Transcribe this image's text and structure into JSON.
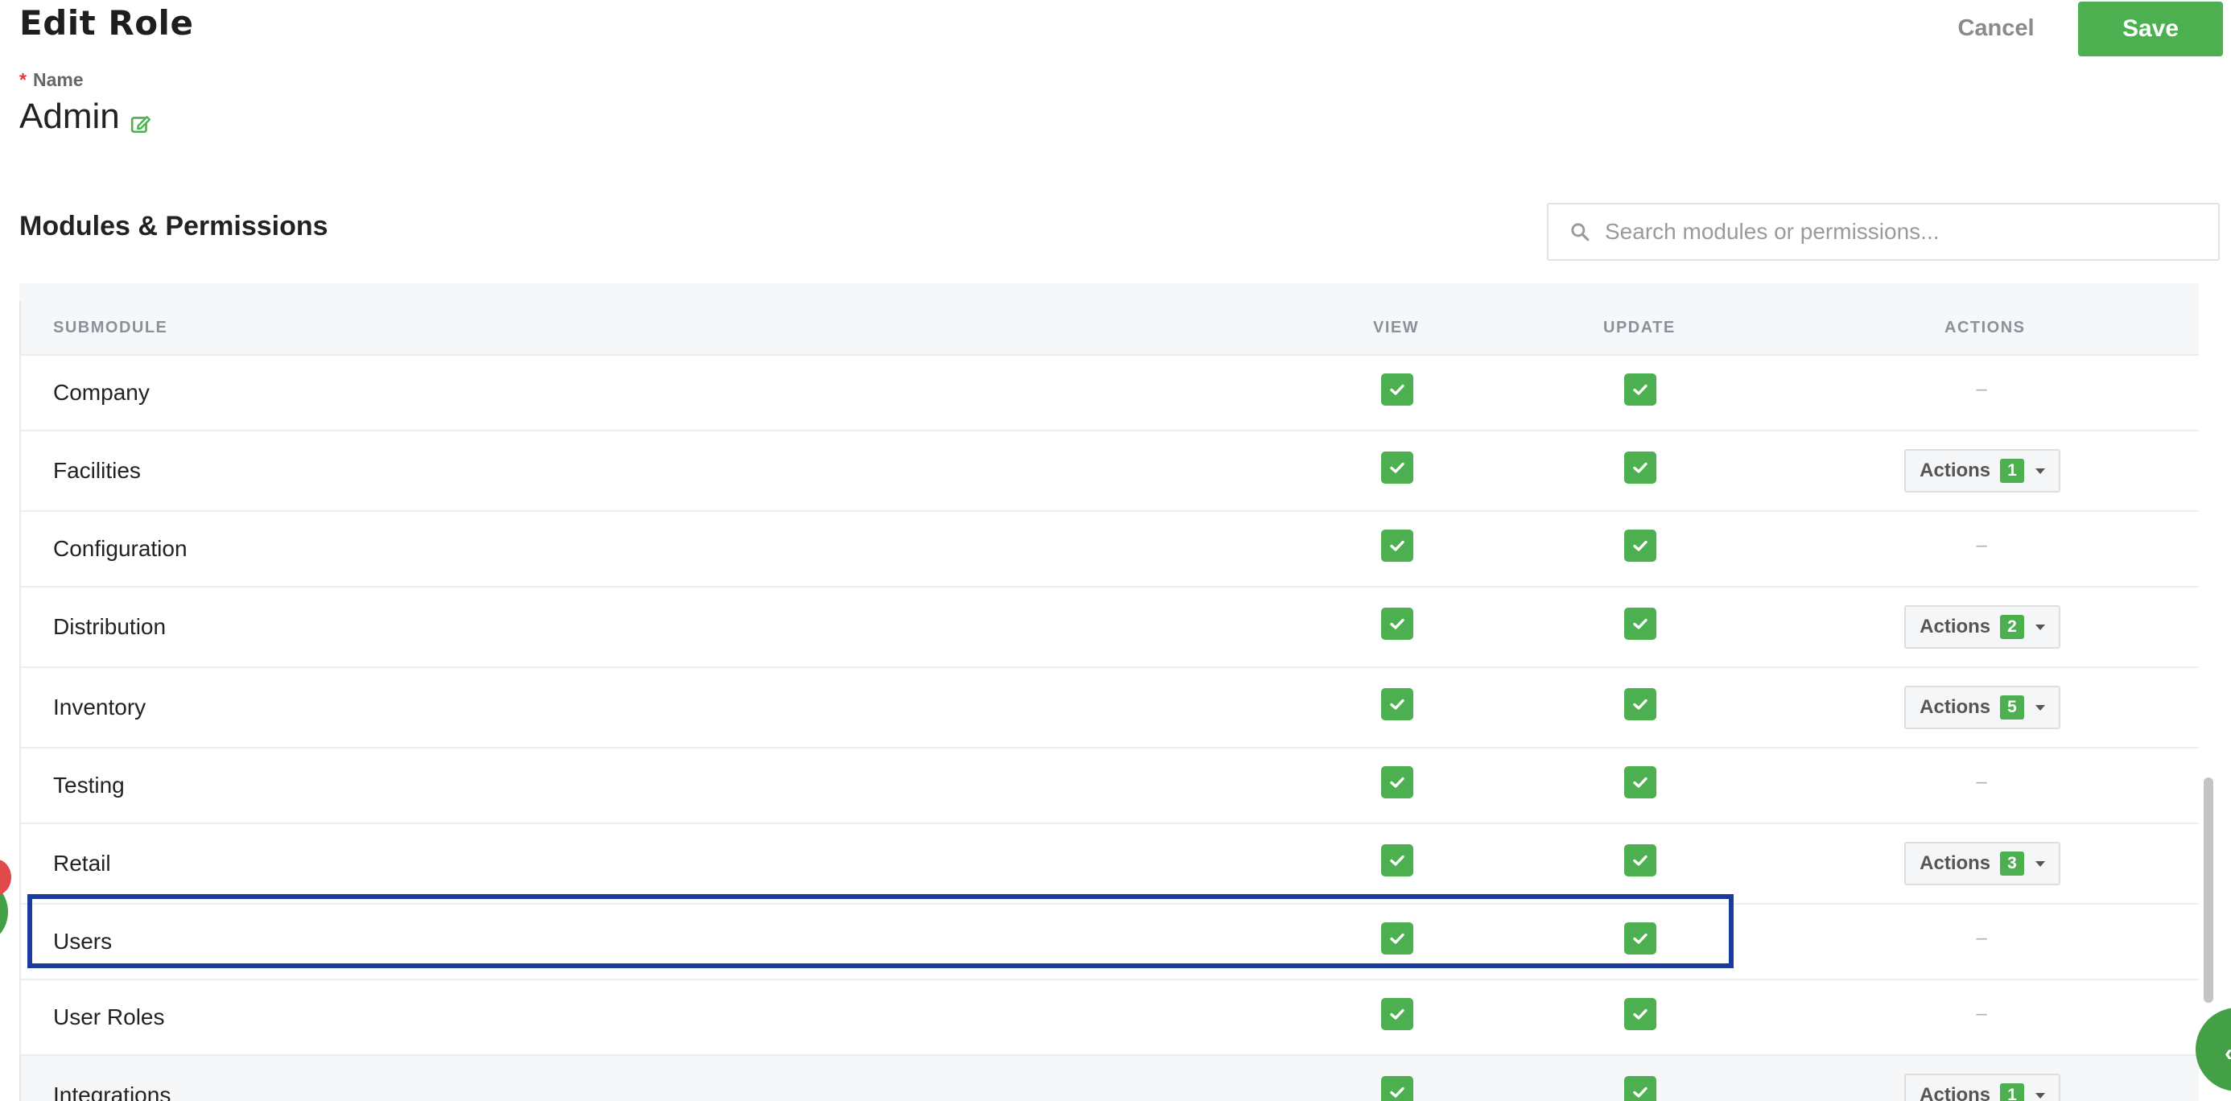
{
  "header": {
    "title": "Edit Role",
    "cancel_label": "Cancel",
    "save_label": "Save"
  },
  "name_field": {
    "required_marker": "*",
    "label": "Name",
    "value": "Admin"
  },
  "permissions": {
    "title": "Modules & Permissions",
    "search_placeholder": "Search modules or permissions...",
    "columns": {
      "submodule": "SUBMODULE",
      "view": "VIEW",
      "update": "UPDATE",
      "actions": "ACTIONS"
    },
    "actions_label": "Actions",
    "empty_placeholder": "–",
    "rows": [
      {
        "name": "Company",
        "view": true,
        "update": true,
        "actions_count": null
      },
      {
        "name": "Facilities",
        "view": true,
        "update": true,
        "actions_count": "1"
      },
      {
        "name": "Configuration",
        "view": true,
        "update": true,
        "actions_count": null
      },
      {
        "name": "Distribution",
        "view": true,
        "update": true,
        "actions_count": "2"
      },
      {
        "name": "Inventory",
        "view": true,
        "update": true,
        "actions_count": "5"
      },
      {
        "name": "Testing",
        "view": true,
        "update": true,
        "actions_count": null
      },
      {
        "name": "Retail",
        "view": true,
        "update": true,
        "actions_count": "3"
      },
      {
        "name": "Users",
        "view": true,
        "update": true,
        "actions_count": null
      },
      {
        "name": "User Roles",
        "view": true,
        "update": true,
        "actions_count": null
      },
      {
        "name": "Integrations",
        "view": true,
        "update": true,
        "actions_count": "1"
      }
    ]
  },
  "colors": {
    "accent": "#4caf50",
    "highlight": "#1a3a9c",
    "required": "#e53935"
  }
}
